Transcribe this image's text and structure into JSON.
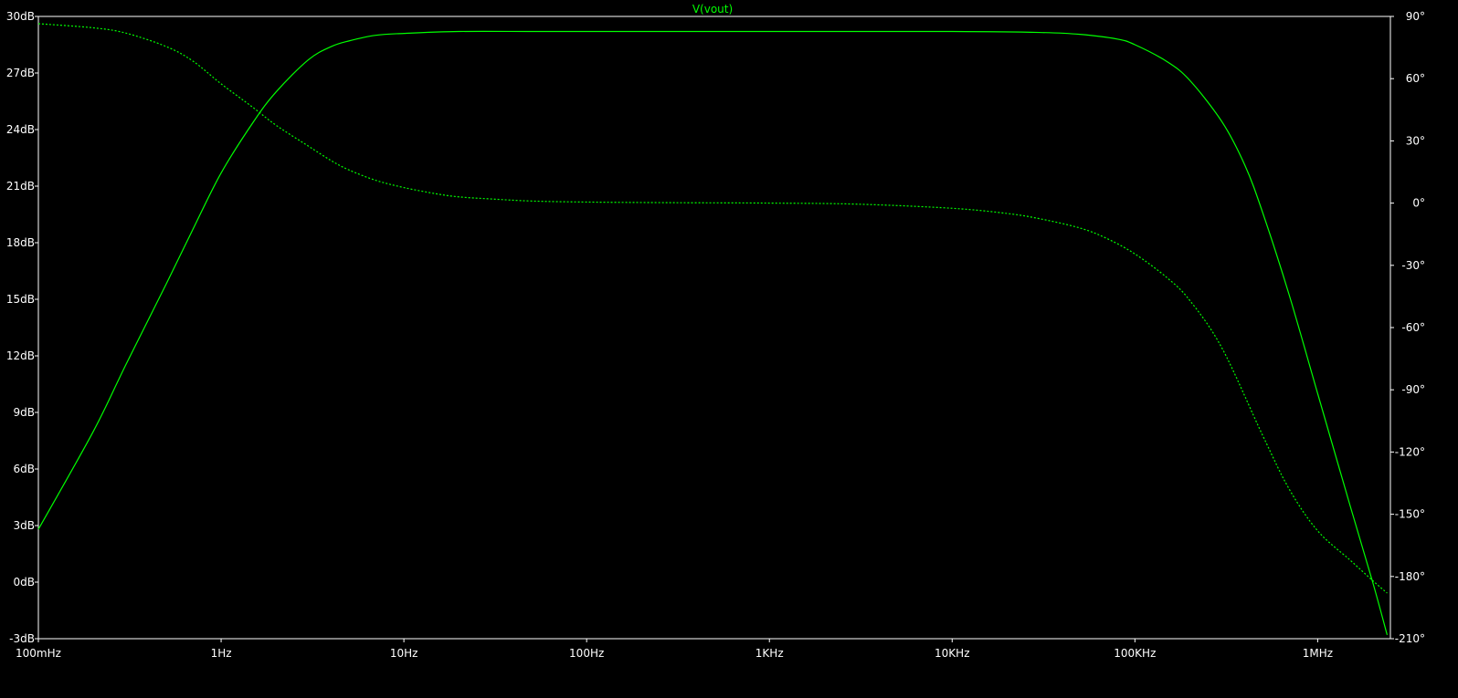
{
  "chart_data": {
    "type": "line",
    "title": "V(vout)",
    "x_scale": "log",
    "xlim": [
      0.1,
      2500000
    ],
    "y_left_lim": [
      -3,
      30
    ],
    "y_right_lim": [
      -210,
      90
    ],
    "x_ticks": [
      {
        "value": 0.1,
        "label": "100mHz"
      },
      {
        "value": 1,
        "label": "1Hz"
      },
      {
        "value": 10,
        "label": "10Hz"
      },
      {
        "value": 100,
        "label": "100Hz"
      },
      {
        "value": 1000,
        "label": "1KHz"
      },
      {
        "value": 10000,
        "label": "10KHz"
      },
      {
        "value": 100000,
        "label": "100KHz"
      },
      {
        "value": 1000000,
        "label": "1MHz"
      }
    ],
    "y_left_ticks": [
      {
        "value": 30,
        "label": "30dB"
      },
      {
        "value": 27,
        "label": "27dB"
      },
      {
        "value": 24,
        "label": "24dB"
      },
      {
        "value": 21,
        "label": "21dB"
      },
      {
        "value": 18,
        "label": "18dB"
      },
      {
        "value": 15,
        "label": "15dB"
      },
      {
        "value": 12,
        "label": "12dB"
      },
      {
        "value": 9,
        "label": "9dB"
      },
      {
        "value": 6,
        "label": "6dB"
      },
      {
        "value": 3,
        "label": "3dB"
      },
      {
        "value": 0,
        "label": "0dB"
      },
      {
        "value": -3,
        "label": "-3dB"
      }
    ],
    "y_right_ticks": [
      {
        "value": 90,
        "label": "90°"
      },
      {
        "value": 60,
        "label": "60°"
      },
      {
        "value": 30,
        "label": "30°"
      },
      {
        "value": 0,
        "label": "0°"
      },
      {
        "value": -30,
        "label": "-30°"
      },
      {
        "value": -60,
        "label": "-60°"
      },
      {
        "value": -90,
        "label": "-90°"
      },
      {
        "value": -120,
        "label": "-120°"
      },
      {
        "value": -150,
        "label": "-150°"
      },
      {
        "value": -180,
        "label": "-180°"
      },
      {
        "value": -210,
        "label": "-210°"
      }
    ],
    "series": [
      {
        "axis": "left",
        "style": "solid",
        "color": "#00ff00",
        "x": [
          0.1,
          0.2,
          0.3,
          0.5,
          0.7,
          1,
          1.5,
          2,
          3,
          4,
          5,
          7,
          10,
          20,
          50,
          100,
          1000,
          10000,
          30000,
          50000,
          80000,
          100000,
          150000,
          200000,
          300000,
          400000,
          500000,
          700000,
          1000000,
          1500000,
          2000000,
          2400000
        ],
        "y": [
          2.8,
          8.0,
          11.5,
          15.8,
          18.7,
          21.7,
          24.4,
          26.0,
          27.7,
          28.4,
          28.7,
          29.0,
          29.1,
          29.2,
          29.2,
          29.2,
          29.2,
          29.2,
          29.15,
          29.05,
          28.8,
          28.5,
          27.6,
          26.6,
          24.4,
          22.1,
          19.6,
          15.2,
          10.0,
          4.1,
          0.0,
          -2.8
        ]
      },
      {
        "axis": "right",
        "style": "dashed",
        "color": "#00ff00",
        "x": [
          0.1,
          0.2,
          0.3,
          0.5,
          0.7,
          1,
          1.5,
          2,
          3,
          4,
          5,
          7,
          10,
          15,
          20,
          30,
          50,
          100,
          300,
          1000,
          3000,
          10000,
          20000,
          30000,
          50000,
          70000,
          100000,
          150000,
          200000,
          300000,
          500000,
          700000,
          1000000,
          1500000,
          2000000,
          2400000
        ],
        "y": [
          86.5,
          84.5,
          82.0,
          75.5,
          68.5,
          57.5,
          46.0,
          37.5,
          27.5,
          20.5,
          16.0,
          11.0,
          7.5,
          4.5,
          3.0,
          2.0,
          1.0,
          0.5,
          0.2,
          0.0,
          -0.5,
          -2.5,
          -5.0,
          -7.5,
          -12.0,
          -17.0,
          -24.5,
          -36.0,
          -47.0,
          -70.0,
          -112.0,
          -138.0,
          -158.0,
          -172.0,
          -182.0,
          -188.0
        ]
      }
    ]
  }
}
